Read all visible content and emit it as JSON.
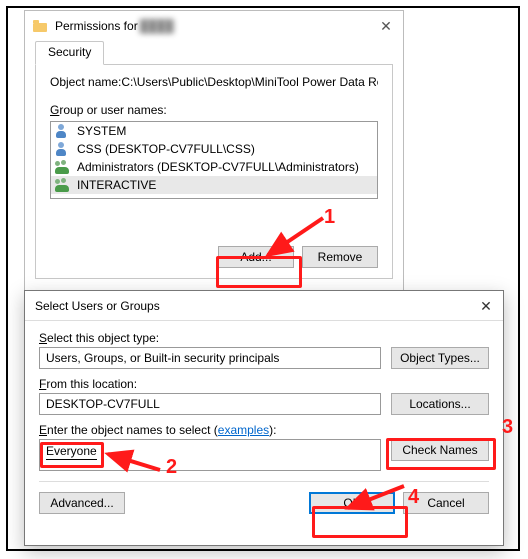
{
  "perm": {
    "title": "Permissions for",
    "title_hidden": "████",
    "tab": "Security",
    "object_name_label": "Object name:",
    "object_name_value": "C:\\Users\\Public\\Desktop\\MiniTool Power Data Re",
    "group_label": "Group or user names:",
    "items": [
      {
        "label": "SYSTEM",
        "kind": "user"
      },
      {
        "label": "CSS (DESKTOP-CV7FULL\\CSS)",
        "kind": "user"
      },
      {
        "label": "Administrators (DESKTOP-CV7FULL\\Administrators)",
        "kind": "group"
      },
      {
        "label": "INTERACTIVE",
        "kind": "group"
      }
    ],
    "add": "Add...",
    "remove": "Remove"
  },
  "sel": {
    "title": "Select Users or Groups",
    "object_type_label": "Select this object type:",
    "object_type_value": "Users, Groups, or Built-in security principals",
    "btn_object_types": "Object Types...",
    "location_label": "From this location:",
    "location_value": "DESKTOP-CV7FULL",
    "btn_locations": "Locations...",
    "enter_label_pre": "Enter the object names to select (",
    "enter_label_link": "examples",
    "enter_label_post": "):",
    "enter_value": "Everyone",
    "btn_check": "Check Names",
    "btn_advanced": "Advanced...",
    "btn_ok": "OK",
    "btn_cancel": "Cancel"
  },
  "ann": {
    "1": "1",
    "2": "2",
    "3": "3",
    "4": "4"
  }
}
